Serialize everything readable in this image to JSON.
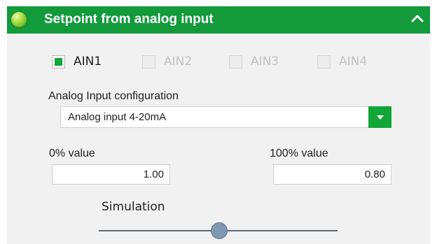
{
  "header": {
    "title": "Setpoint from analog input",
    "status_color": "#9fd83a",
    "collapse_icon": "chevron-up-icon"
  },
  "inputs": [
    {
      "label": "AIN1",
      "checked": true,
      "enabled": true
    },
    {
      "label": "AIN2",
      "checked": false,
      "enabled": false
    },
    {
      "label": "AIN3",
      "checked": false,
      "enabled": false
    },
    {
      "label": "AIN4",
      "checked": false,
      "enabled": false
    }
  ],
  "config": {
    "label": "Analog Input configuration",
    "value": "Analog input 4-20mA"
  },
  "zero": {
    "label": "0% value",
    "value": "1.00"
  },
  "hundred": {
    "label": "100% value",
    "value": "0.80"
  },
  "simulation": {
    "label": "Simulation",
    "level": 0.51
  },
  "colors": {
    "accent": "#129a3b",
    "check": "#12a63a",
    "slider": "#7f97b3"
  }
}
